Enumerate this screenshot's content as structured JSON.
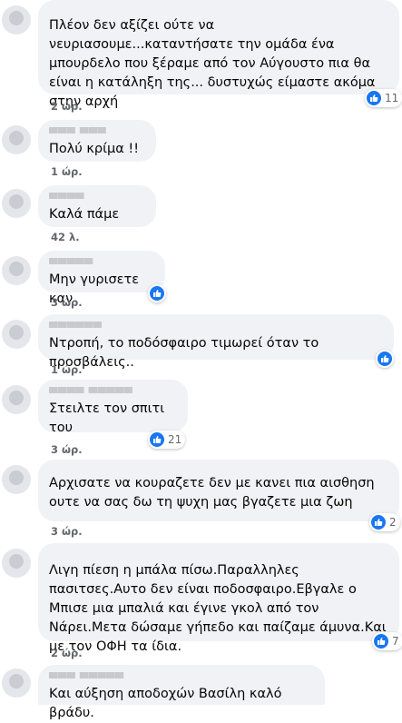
{
  "comments": [
    {
      "text": "Πλέον δεν αξίζει ούτε να νευριασουμε...καταντήσατε την ομάδα ένα μπουρδελο που ξέραμε από τον Αύγουστο πια θα είναι η κατάληξη της... δυστυχώς είμαστε ακόμα στην αρχή",
      "time": "2 ώρ.",
      "likes": "11"
    },
    {
      "text": "Πολύ κρίμα !!",
      "time": "1 ώρ."
    },
    {
      "text": "Καλά πάμε",
      "time": "42 λ."
    },
    {
      "text": "Μην γυρισετε καν",
      "time": "3 ώρ.",
      "likes": ""
    },
    {
      "text": "Ντροπή, το ποδόσφαιρο τιμωρεί όταν το προσβάλεις..",
      "time": "1 ώρ.",
      "likes": ""
    },
    {
      "text": "Στειλτε τον σπιτι του",
      "time": "3 ώρ.",
      "likes": "21"
    },
    {
      "text": "Αρχισατε να κουραζετε δεν με κανει πια αισθηση ουτε να σας δω τη ψυχη μας βγαζετε μια ζωη",
      "time": "3 ώρ.",
      "likes": "2"
    },
    {
      "text": "Λιγη πίεση η μπάλα πίσω.Παραλληλες πασιτσες.Αυτο δεν είναι ποδοσφαιρο.Εβγαλε ο Μπισε μια μπαλιά και έγινε γκολ από τον Νάρει.Μετα δώσαμε γήπεδο και παίζαμε άμυνα.Και με τον ΟΦΗ τα ίδια.",
      "time": "2 ώρ.",
      "likes": "7"
    },
    {
      "text": "Και αύξηση αποδοχών Βασίλη καλό βράδυ."
    }
  ],
  "icons": {
    "reaction": "like-icon"
  },
  "colors": {
    "bubble": "#f0f2f5",
    "like": "#1877f2",
    "meta": "#65676b"
  }
}
